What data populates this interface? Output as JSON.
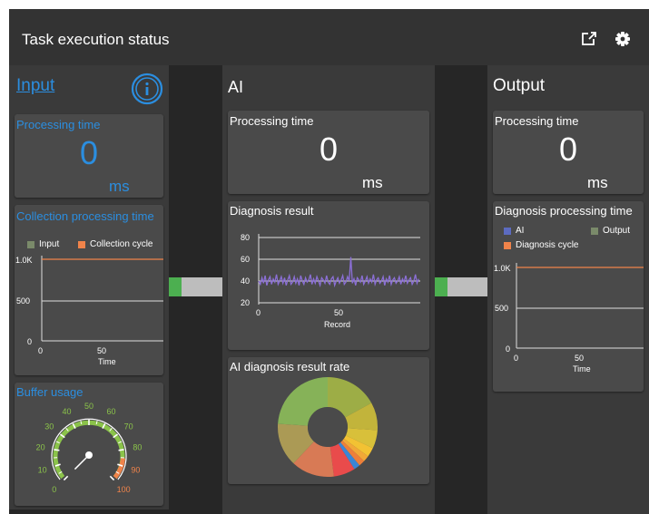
{
  "header": {
    "title": "Task execution status",
    "icons": [
      "open-external-icon",
      "gear-icon"
    ]
  },
  "input": {
    "title": "Input",
    "processing": {
      "label": "Processing time",
      "value": "0",
      "unit": "ms"
    },
    "collection": {
      "label": "Collection processing time",
      "legend": [
        "Input",
        "Collection cycle"
      ],
      "y_ticks": [
        "1.0K",
        "500",
        "0"
      ],
      "x_ticks": [
        "0",
        "50"
      ],
      "xlabel": "Time"
    },
    "buffer": {
      "label": "Buffer usage",
      "ticks": [
        "0",
        "10",
        "20",
        "30",
        "40",
        "50",
        "60",
        "70",
        "80",
        "90",
        "100"
      ],
      "value": 0
    }
  },
  "ai": {
    "title": "AI",
    "processing": {
      "label": "Processing time",
      "value": "0",
      "unit": "ms"
    },
    "diagnosis": {
      "label": "Diagnosis result",
      "y_ticks": [
        "80",
        "60",
        "40",
        "20"
      ],
      "x_ticks": [
        "0",
        "50"
      ],
      "xlabel": "Record"
    },
    "rate": {
      "label": "AI diagnosis result rate"
    }
  },
  "output": {
    "title": "Output",
    "processing": {
      "label": "Processing time",
      "value": "0",
      "unit": "ms"
    },
    "diagnosis_time": {
      "label": "Diagnosis processing time",
      "legend": [
        "AI",
        "Output",
        "Diagnosis cycle"
      ],
      "y_ticks": [
        "1.0K",
        "500",
        "0"
      ],
      "x_ticks": [
        "0",
        "50"
      ],
      "xlabel": "Time"
    }
  },
  "colors": {
    "accent": "#2b8ee0",
    "green": "#4caf50",
    "orange": "#f0834a",
    "ai_series": "#5c6bc0",
    "output_series": "#7a8a6a",
    "diagnosis_line": "#8b6fd6"
  },
  "chart_data": [
    {
      "type": "line",
      "xlabel": "Time",
      "ylim": [
        0,
        1000
      ],
      "xlim": [
        0,
        95
      ],
      "series": [
        {
          "name": "Input",
          "values": []
        },
        {
          "name": "Collection cycle",
          "x": [
            0,
            95
          ],
          "values": [
            1000,
            1000
          ]
        }
      ]
    },
    {
      "type": "line",
      "xlabel": "Record",
      "ylim": [
        20,
        80
      ],
      "xlim": [
        0,
        100
      ],
      "series": [
        {
          "values": [
            40,
            37,
            43,
            38,
            45,
            36,
            41,
            44,
            37,
            42,
            39,
            46,
            37,
            40,
            44,
            38,
            43,
            36,
            41,
            45,
            37,
            39,
            44,
            38,
            42,
            36,
            45,
            40,
            37,
            43,
            39,
            41,
            46,
            37,
            42,
            38,
            44,
            40,
            36,
            43,
            41,
            38,
            45,
            39,
            37,
            42,
            44,
            36,
            40,
            43,
            38,
            41,
            45,
            37,
            39,
            44,
            40,
            62,
            38,
            42,
            36,
            43,
            41,
            39,
            45,
            37,
            40,
            44,
            38,
            42,
            39,
            46,
            37,
            41,
            43,
            38,
            40,
            44,
            36,
            42,
            39,
            45,
            37,
            41,
            43,
            38,
            40,
            44,
            37,
            42,
            39,
            45,
            38,
            41,
            43,
            37,
            40,
            46,
            38,
            42
          ]
        }
      ]
    },
    {
      "type": "pie",
      "values": [
        17,
        9,
        6,
        3,
        2,
        2,
        2,
        7,
        14,
        14,
        24
      ],
      "colors": [
        "#9dad46",
        "#c2b43b",
        "#d8c03a",
        "#f2c233",
        "#f1a837",
        "#ed7f3a",
        "#3b86d6",
        "#e94b4b",
        "#d87a55",
        "#ab9a55",
        "#86b258"
      ]
    },
    {
      "type": "line",
      "xlabel": "Time",
      "ylim": [
        0,
        1000
      ],
      "xlim": [
        0,
        95
      ],
      "series": [
        {
          "name": "AI",
          "values": []
        },
        {
          "name": "Output",
          "values": []
        },
        {
          "name": "Diagnosis cycle",
          "x": [
            0,
            95
          ],
          "values": [
            1000,
            1000
          ]
        }
      ]
    }
  ]
}
